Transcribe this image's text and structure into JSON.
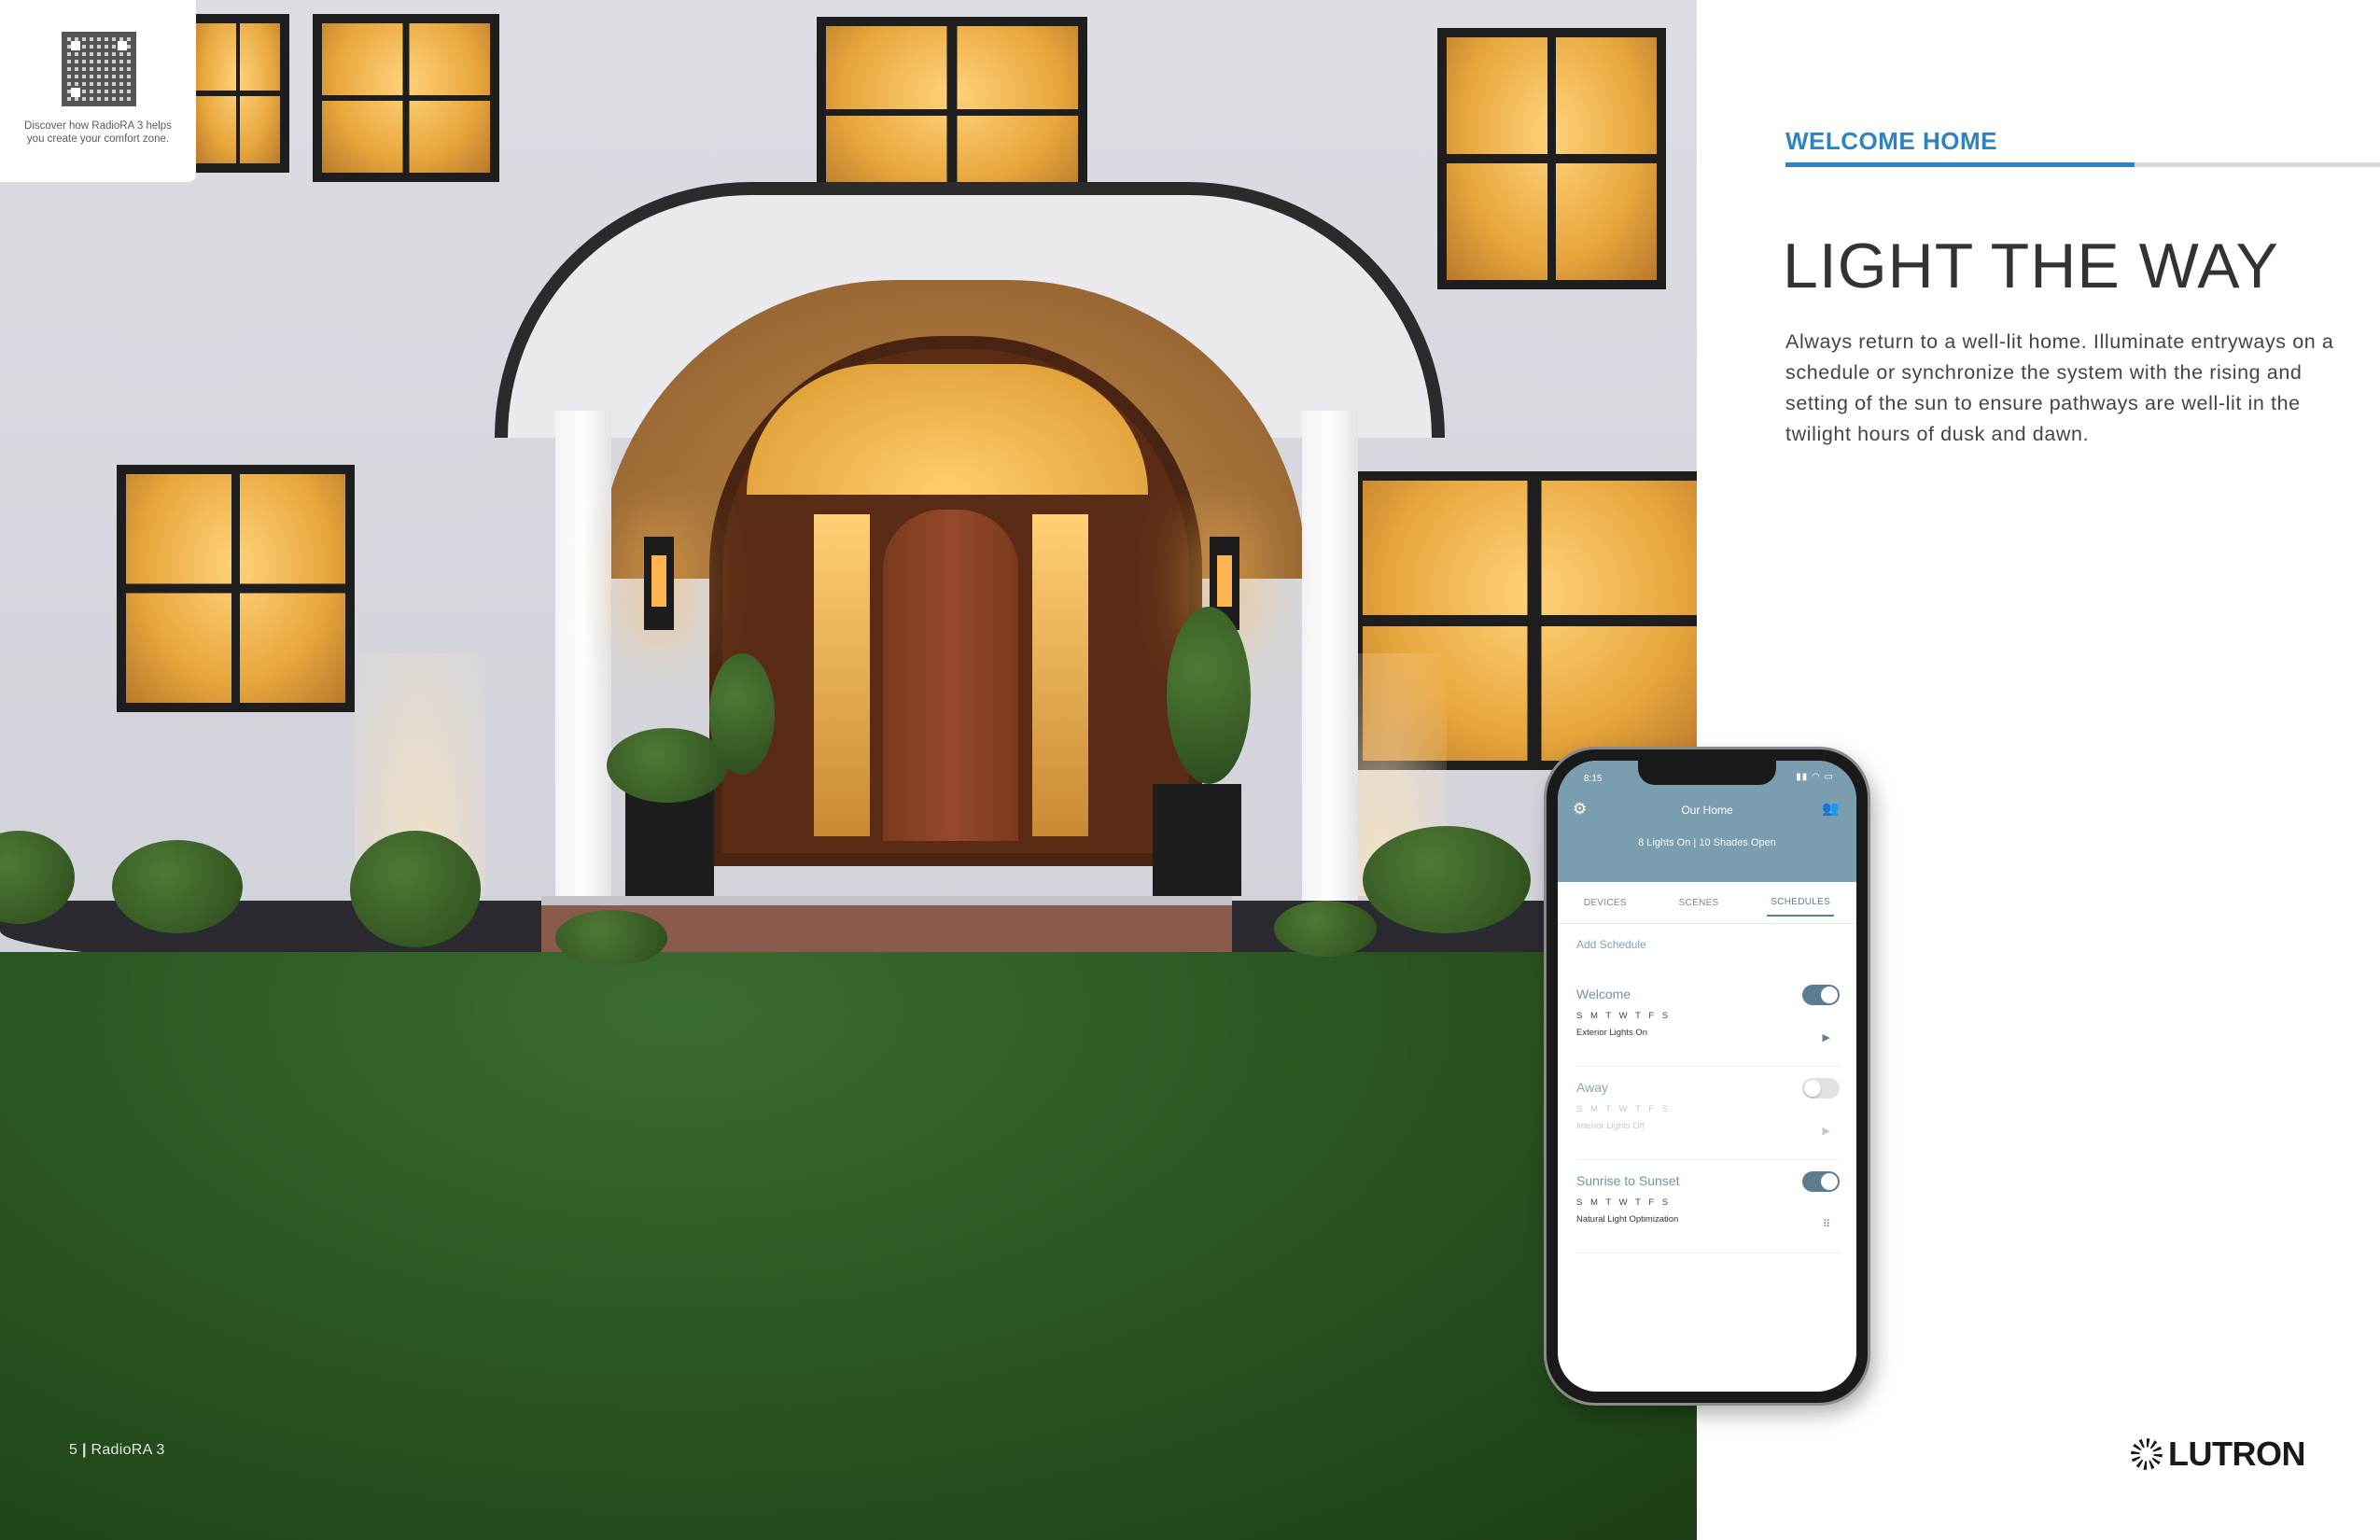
{
  "qr_card": {
    "caption": "Discover how RadioRA 3 helps you create your comfort zone."
  },
  "folio": {
    "page_number": "5",
    "separator": "|",
    "product": "RadioRA 3"
  },
  "section": {
    "kicker": "WELCOME HOME",
    "headline": "LIGHT THE WAY",
    "body": "Always return to a well-lit home. Illuminate entryways on a schedule or synchronize the system with the rising and setting of the sun to ensure pathways are well-lit in the twilight hours of dusk and dawn."
  },
  "brand": {
    "logo_text": "LUTRON"
  },
  "app": {
    "status_time": "8:15",
    "status_icons": "▮▮ ◠ ▭",
    "header_title": "Our Home",
    "header_status": "8 Lights On | 10 Shades Open",
    "tabs": [
      "DEVICES",
      "SCENES",
      "SCHEDULES"
    ],
    "active_tab": "SCHEDULES",
    "add_schedule": "Add Schedule",
    "schedules": [
      {
        "name": "Welcome",
        "days": "S M T W T F S",
        "action": "Exterior Lights On",
        "enabled": true
      },
      {
        "name": "Away",
        "days": "S M T W T F S",
        "action": "Interior Lights Off",
        "enabled": false
      },
      {
        "name": "Sunrise to Sunset",
        "days": "S M T W T F S",
        "action": "Natural Light Optimization",
        "enabled": true
      }
    ]
  },
  "colors": {
    "accent_blue": "#2f83bf",
    "app_header": "#7a9db0",
    "headline_text": "#333333"
  },
  "icons": {
    "settings": "gear-icon",
    "people": "people-icon",
    "play": "play-icon",
    "logo": "lutron-starburst-icon"
  }
}
